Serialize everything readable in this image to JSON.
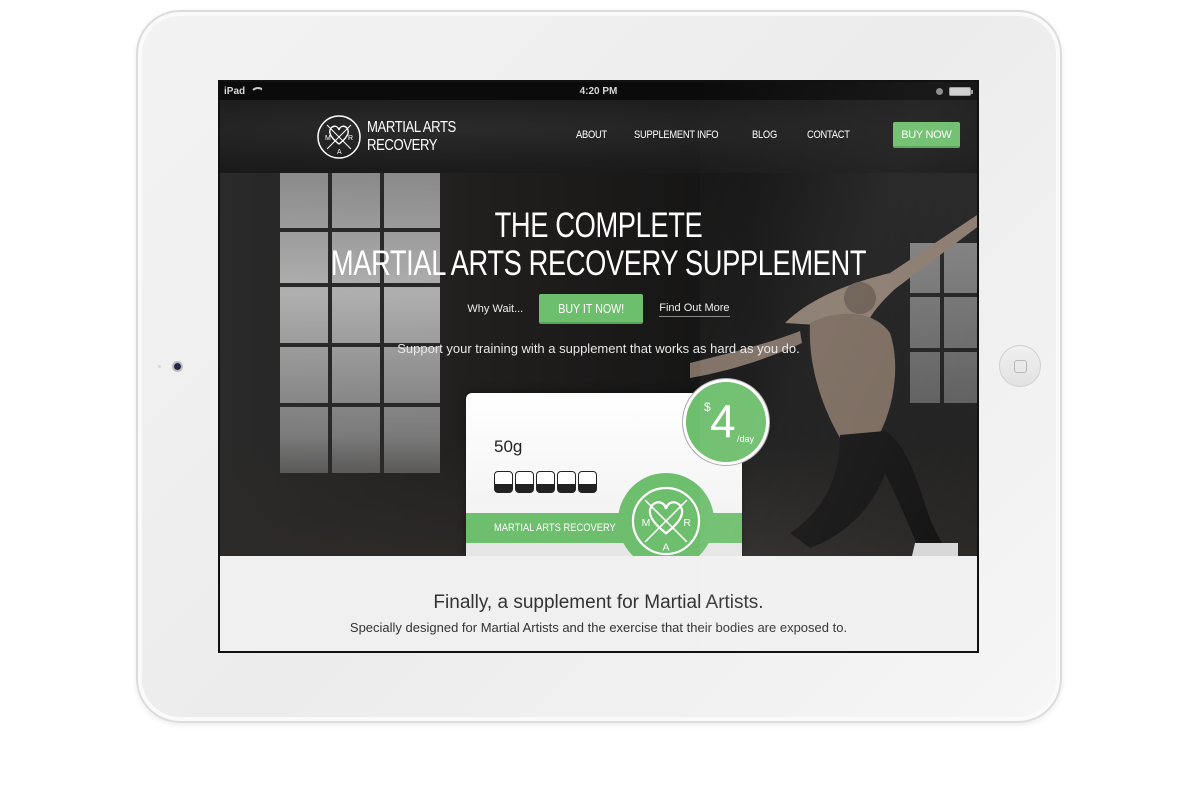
{
  "device": {
    "statusbar": {
      "carrier": "iPad",
      "time": "4:20 PM"
    }
  },
  "header": {
    "logo": {
      "line1": "MARTIAL ARTS",
      "line2": "RECOVERY",
      "letters": [
        "M",
        "R",
        "A"
      ]
    },
    "nav": [
      {
        "label": "ABOUT"
      },
      {
        "label": "SUPPLEMENT INFO"
      },
      {
        "label": "BLOG"
      },
      {
        "label": "CONTACT"
      }
    ],
    "buy_label": "BUY NOW"
  },
  "hero": {
    "title_line1": "THE COMPLETE",
    "title_line2": "MARTIAL ARTS RECOVERY SUPPLEMENT",
    "cta_prefix": "Why Wait...",
    "cta_button": "BUY IT NOW!",
    "cta_link": "Find Out More",
    "subtitle": "Support your training with a supplement that works as hard as you do."
  },
  "product": {
    "weight": "50g",
    "brand_band": "MARTIAL ARTS RECOVERY",
    "logo_letters": [
      "M",
      "R",
      "A"
    ],
    "price": {
      "currency": "$",
      "value": "4",
      "unit": "/day"
    }
  },
  "intro": {
    "title": "Finally, a supplement for Martial Artists.",
    "subtitle": "Specially designed for Martial Artists and the exercise that their bodies are exposed to."
  },
  "colors": {
    "accent": "#6dbe6d",
    "header_bg": "#1c1c1c",
    "intro_bg": "#f0f0f0"
  }
}
